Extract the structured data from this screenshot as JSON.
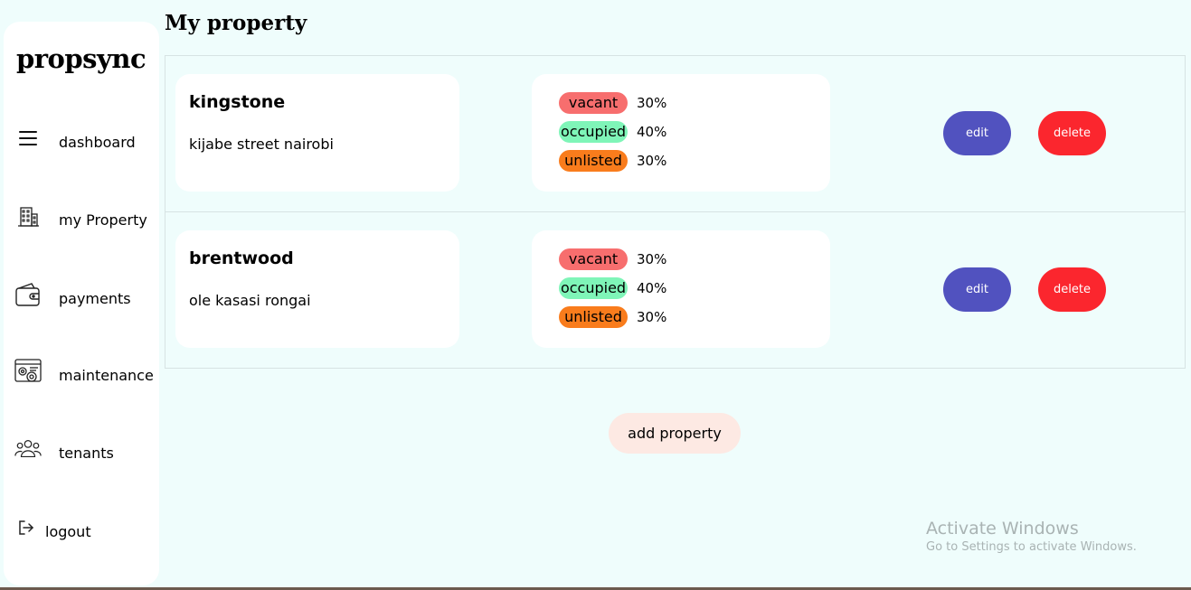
{
  "sidebar": {
    "brand": "propsync",
    "items": [
      {
        "label": "dashboard",
        "icon": "menu-icon"
      },
      {
        "label": "my Property",
        "icon": "building-icon"
      },
      {
        "label": "payments",
        "icon": "wallet-icon"
      },
      {
        "label": "maintenance",
        "icon": "settings-icon"
      },
      {
        "label": "tenants",
        "icon": "users-icon"
      }
    ],
    "logout": {
      "label": "logout",
      "icon": "logout-icon"
    }
  },
  "main": {
    "title": "My property",
    "properties": [
      {
        "name": "kingstone",
        "address": "kijabe street nairobi",
        "statuses": [
          {
            "label": "vacant",
            "percent": "30%"
          },
          {
            "label": "occupied",
            "percent": "40%"
          },
          {
            "label": "unlisted",
            "percent": "30%"
          }
        ],
        "edit_label": "edit",
        "delete_label": "delete"
      },
      {
        "name": "brentwood",
        "address": "ole kasasi rongai",
        "statuses": [
          {
            "label": "vacant",
            "percent": "30%"
          },
          {
            "label": "occupied",
            "percent": "40%"
          },
          {
            "label": "unlisted",
            "percent": "30%"
          }
        ],
        "edit_label": "edit",
        "delete_label": "delete"
      }
    ],
    "add_label": "add property"
  },
  "watermark": {
    "title": "Activate Windows",
    "subtitle": "Go to Settings to activate Windows."
  },
  "colors": {
    "background": "#effdfc",
    "vacant": "#f76e6e",
    "occupied": "#7ff5b8",
    "unlisted": "#f97c1c",
    "edit": "#5152bf",
    "delete": "#fb262e",
    "add": "#fde9e3"
  }
}
